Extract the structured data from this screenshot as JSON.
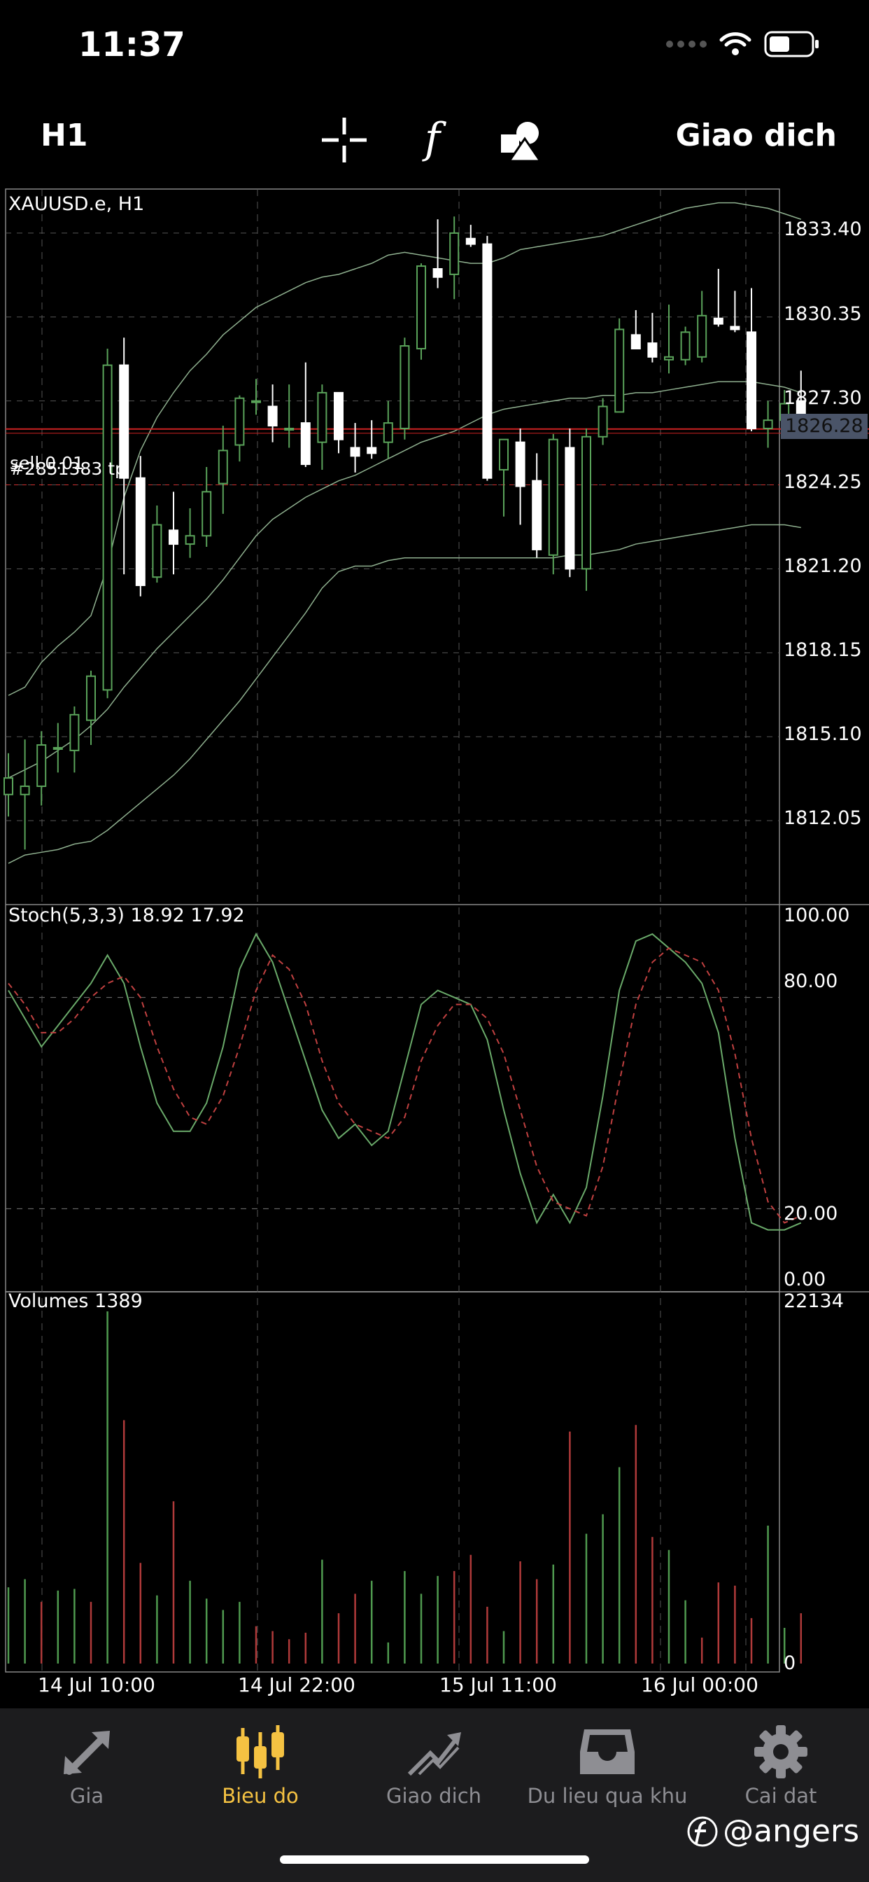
{
  "status_bar": {
    "time": "11:37"
  },
  "toolbar": {
    "period": "H1",
    "trade_label": "Giao dich"
  },
  "chart": {
    "symbol_label": "XAUUSD.e, H1",
    "order_label_1": "sell 0.01",
    "order_label_2": "#2851383 tp",
    "price_axis": [
      "1833.40",
      "1830.35",
      "1827.30",
      "1824.25",
      "1821.20",
      "1818.15",
      "1815.10",
      "1812.05"
    ],
    "current_price": "1826.28",
    "time_axis": [
      "14 Jul 10:00",
      "14 Jul 22:00",
      "15 Jul 11:00",
      "16 Jul 00:00"
    ],
    "colors": {
      "bull": "#5aa35a",
      "bear": "#ffffff",
      "band": "#8fb08f",
      "order_line": "#d03030",
      "grid": "#555555"
    }
  },
  "stochastic": {
    "label": "Stoch(5,3,3) 18.92 17.92",
    "axis": [
      "100.00",
      "80.00",
      "20.00",
      "0.00"
    ],
    "colors": {
      "main": "#6aaa6a",
      "signal": "#c04040"
    }
  },
  "volumes": {
    "label": "Volumes 1389",
    "axis_max": "22134",
    "axis_min": "0"
  },
  "tabs": [
    {
      "label": "Gia",
      "icon": "arrows-icon",
      "active": false
    },
    {
      "label": "Bieu do",
      "icon": "candlestick-icon",
      "active": true
    },
    {
      "label": "Giao dich",
      "icon": "trend-icon",
      "active": false
    },
    {
      "label": "Du lieu qua khu",
      "icon": "inbox-icon",
      "active": false
    },
    {
      "label": "Cai dat",
      "icon": "gear-icon",
      "active": false
    }
  ],
  "watermark": {
    "text": "@angers"
  },
  "chart_data": [
    {
      "type": "candlestick",
      "title": "XAUUSD.e, H1",
      "ylim": [
        1809.0,
        1835.0
      ],
      "candles": [
        {
          "o": 1813.0,
          "h": 1814.5,
          "l": 1812.2,
          "c": 1813.6
        },
        {
          "o": 1813.0,
          "h": 1815.0,
          "l": 1811.0,
          "c": 1813.3
        },
        {
          "o": 1813.3,
          "h": 1815.3,
          "l": 1812.6,
          "c": 1814.8
        },
        {
          "o": 1814.7,
          "h": 1815.6,
          "l": 1813.8,
          "c": 1814.7
        },
        {
          "o": 1814.6,
          "h": 1816.2,
          "l": 1813.8,
          "c": 1815.9
        },
        {
          "o": 1815.7,
          "h": 1817.5,
          "l": 1814.8,
          "c": 1817.3
        },
        {
          "o": 1816.8,
          "h": 1829.2,
          "l": 1816.5,
          "c": 1828.6
        },
        {
          "o": 1828.6,
          "h": 1829.6,
          "l": 1821.0,
          "c": 1824.5
        },
        {
          "o": 1824.5,
          "h": 1825.3,
          "l": 1820.2,
          "c": 1820.6
        },
        {
          "o": 1820.9,
          "h": 1823.5,
          "l": 1820.7,
          "c": 1822.8
        },
        {
          "o": 1822.6,
          "h": 1824.0,
          "l": 1821.0,
          "c": 1822.1
        },
        {
          "o": 1822.1,
          "h": 1823.4,
          "l": 1821.6,
          "c": 1822.4
        },
        {
          "o": 1822.4,
          "h": 1824.9,
          "l": 1822.0,
          "c": 1824.0
        },
        {
          "o": 1824.3,
          "h": 1826.4,
          "l": 1823.2,
          "c": 1825.5
        },
        {
          "o": 1825.7,
          "h": 1827.5,
          "l": 1825.1,
          "c": 1827.4
        },
        {
          "o": 1827.3,
          "h": 1828.1,
          "l": 1826.8,
          "c": 1827.3
        },
        {
          "o": 1827.1,
          "h": 1827.9,
          "l": 1825.8,
          "c": 1826.4
        },
        {
          "o": 1826.3,
          "h": 1827.9,
          "l": 1825.6,
          "c": 1826.3
        },
        {
          "o": 1826.5,
          "h": 1828.7,
          "l": 1824.9,
          "c": 1825.0
        },
        {
          "o": 1825.8,
          "h": 1827.9,
          "l": 1824.8,
          "c": 1827.6
        },
        {
          "o": 1827.6,
          "h": 1827.6,
          "l": 1825.4,
          "c": 1825.9
        },
        {
          "o": 1825.6,
          "h": 1826.5,
          "l": 1824.7,
          "c": 1825.3
        },
        {
          "o": 1825.6,
          "h": 1826.6,
          "l": 1825.2,
          "c": 1825.4
        },
        {
          "o": 1825.8,
          "h": 1827.3,
          "l": 1825.2,
          "c": 1826.5
        },
        {
          "o": 1826.3,
          "h": 1829.6,
          "l": 1825.9,
          "c": 1829.3
        },
        {
          "o": 1829.2,
          "h": 1832.3,
          "l": 1828.8,
          "c": 1832.2
        },
        {
          "o": 1832.1,
          "h": 1833.9,
          "l": 1831.4,
          "c": 1831.8
        },
        {
          "o": 1831.9,
          "h": 1834.0,
          "l": 1831.0,
          "c": 1833.4
        },
        {
          "o": 1833.2,
          "h": 1833.7,
          "l": 1832.9,
          "c": 1833.0
        },
        {
          "o": 1833.0,
          "h": 1833.3,
          "l": 1824.4,
          "c": 1824.5
        },
        {
          "o": 1824.8,
          "h": 1825.9,
          "l": 1823.1,
          "c": 1825.9
        },
        {
          "o": 1825.8,
          "h": 1826.3,
          "l": 1822.8,
          "c": 1824.2
        },
        {
          "o": 1824.4,
          "h": 1825.4,
          "l": 1821.6,
          "c": 1821.9
        },
        {
          "o": 1821.7,
          "h": 1826.1,
          "l": 1821.0,
          "c": 1825.9
        },
        {
          "o": 1825.6,
          "h": 1826.3,
          "l": 1820.9,
          "c": 1821.2
        },
        {
          "o": 1821.2,
          "h": 1826.3,
          "l": 1820.4,
          "c": 1826.0
        },
        {
          "o": 1826.0,
          "h": 1827.4,
          "l": 1825.7,
          "c": 1827.1
        },
        {
          "o": 1826.9,
          "h": 1830.3,
          "l": 1826.9,
          "c": 1829.9
        },
        {
          "o": 1829.7,
          "h": 1830.6,
          "l": 1829.2,
          "c": 1829.2
        },
        {
          "o": 1829.4,
          "h": 1830.5,
          "l": 1828.7,
          "c": 1828.9
        },
        {
          "o": 1828.8,
          "h": 1830.8,
          "l": 1828.3,
          "c": 1828.9
        },
        {
          "o": 1828.8,
          "h": 1830.0,
          "l": 1828.6,
          "c": 1829.8
        },
        {
          "o": 1828.9,
          "h": 1831.3,
          "l": 1828.7,
          "c": 1830.4
        },
        {
          "o": 1830.3,
          "h": 1832.1,
          "l": 1830.0,
          "c": 1830.1
        },
        {
          "o": 1830.0,
          "h": 1831.3,
          "l": 1829.8,
          "c": 1829.9
        },
        {
          "o": 1829.8,
          "h": 1831.4,
          "l": 1826.2,
          "c": 1826.3
        },
        {
          "o": 1826.3,
          "h": 1827.3,
          "l": 1825.6,
          "c": 1826.6
        },
        {
          "o": 1826.6,
          "h": 1827.7,
          "l": 1826.0,
          "c": 1827.2
        },
        {
          "o": 1827.3,
          "h": 1828.4,
          "l": 1826.1,
          "c": 1826.3
        }
      ],
      "bollinger_upper": [
        1816.6,
        1816.9,
        1817.8,
        1818.4,
        1818.9,
        1819.5,
        1821.3,
        1823.8,
        1825.5,
        1826.7,
        1827.6,
        1828.4,
        1829.0,
        1829.7,
        1830.2,
        1830.7,
        1831.0,
        1831.3,
        1831.6,
        1831.8,
        1831.9,
        1832.1,
        1832.3,
        1832.6,
        1832.7,
        1832.6,
        1832.5,
        1832.4,
        1832.3,
        1832.3,
        1832.5,
        1832.8,
        1832.9,
        1833.0,
        1833.1,
        1833.2,
        1833.3,
        1833.5,
        1833.7,
        1833.9,
        1834.1,
        1834.3,
        1834.4,
        1834.5,
        1834.5,
        1834.4,
        1834.3,
        1834.1,
        1833.9
      ],
      "bollinger_middle": [
        1813.6,
        1813.9,
        1814.2,
        1814.6,
        1815.0,
        1815.5,
        1816.1,
        1816.9,
        1817.6,
        1818.3,
        1818.9,
        1819.5,
        1820.1,
        1820.8,
        1821.6,
        1822.4,
        1823.0,
        1823.4,
        1823.8,
        1824.1,
        1824.4,
        1824.6,
        1824.9,
        1825.2,
        1825.5,
        1825.8,
        1826.0,
        1826.2,
        1826.5,
        1826.8,
        1827.0,
        1827.1,
        1827.2,
        1827.3,
        1827.4,
        1827.4,
        1827.5,
        1827.5,
        1827.6,
        1827.6,
        1827.7,
        1827.8,
        1827.9,
        1828.0,
        1828.0,
        1828.0,
        1827.9,
        1827.8,
        1827.6
      ],
      "bollinger_lower": [
        1810.5,
        1810.8,
        1810.9,
        1811.0,
        1811.2,
        1811.3,
        1811.7,
        1812.2,
        1812.7,
        1813.2,
        1813.7,
        1814.3,
        1815.0,
        1815.7,
        1816.4,
        1817.2,
        1818.0,
        1818.8,
        1819.6,
        1820.5,
        1821.1,
        1821.3,
        1821.3,
        1821.5,
        1821.6,
        1821.6,
        1821.6,
        1821.6,
        1821.6,
        1821.6,
        1821.6,
        1821.6,
        1821.6,
        1821.6,
        1821.7,
        1821.7,
        1821.8,
        1821.9,
        1822.1,
        1822.2,
        1822.3,
        1822.4,
        1822.5,
        1822.6,
        1822.7,
        1822.8,
        1822.8,
        1822.8,
        1822.7
      ],
      "order_line": 1824.25,
      "current_price": 1826.28
    },
    {
      "type": "line",
      "title": "Stoch(5,3,3) 18.92 17.92",
      "ylim": [
        0,
        100
      ],
      "series": [
        {
          "name": "main",
          "values": [
            82,
            74,
            66,
            72,
            78,
            84,
            92,
            84,
            66,
            50,
            42,
            42,
            50,
            66,
            88,
            98,
            90,
            76,
            62,
            48,
            40,
            44,
            38,
            42,
            60,
            78,
            82,
            80,
            78,
            68,
            48,
            30,
            16,
            24,
            16,
            26,
            52,
            82,
            96,
            98,
            94,
            90,
            84,
            70,
            40,
            16,
            14,
            14,
            16
          ]
        },
        {
          "name": "signal",
          "values": [
            84,
            78,
            70,
            70,
            74,
            80,
            84,
            86,
            80,
            66,
            54,
            46,
            44,
            52,
            66,
            82,
            92,
            88,
            78,
            62,
            50,
            44,
            42,
            40,
            46,
            62,
            72,
            78,
            78,
            74,
            64,
            48,
            32,
            22,
            20,
            18,
            32,
            56,
            78,
            90,
            94,
            92,
            90,
            82,
            64,
            40,
            22,
            16,
            18
          ]
        }
      ]
    },
    {
      "type": "bar",
      "title": "Volumes 1389",
      "ylim": [
        0,
        22134
      ],
      "values": [
        4700,
        5200,
        3800,
        4500,
        4600,
        3800,
        21700,
        15000,
        6200,
        4200,
        10000,
        5100,
        4000,
        3300,
        3800,
        2300,
        2000,
        1500,
        1900,
        6400,
        3100,
        4300,
        5100,
        1300,
        5700,
        4300,
        5400,
        5700,
        6700,
        3500,
        2000,
        6300,
        5200,
        6100,
        14300,
        8000,
        9200,
        12100,
        14700,
        7800,
        7000,
        3900,
        1600,
        5000,
        4800,
        2800,
        8500,
        2200,
        3100
      ],
      "directions": [
        "bull",
        "bull",
        "bear",
        "bull",
        "bull",
        "bear",
        "bull",
        "bear",
        "bear",
        "bull",
        "bear",
        "bull",
        "bull",
        "bull",
        "bull",
        "bear",
        "bear",
        "bear",
        "bear",
        "bull",
        "bear",
        "bear",
        "bull",
        "bull",
        "bull",
        "bull",
        "bull",
        "bear",
        "bear",
        "bear",
        "bull",
        "bear",
        "bear",
        "bull",
        "bear",
        "bull",
        "bull",
        "bull",
        "bear",
        "bear",
        "bull",
        "bull",
        "bear",
        "bear",
        "bear",
        "bear",
        "bull",
        "bull",
        "bear"
      ]
    }
  ]
}
